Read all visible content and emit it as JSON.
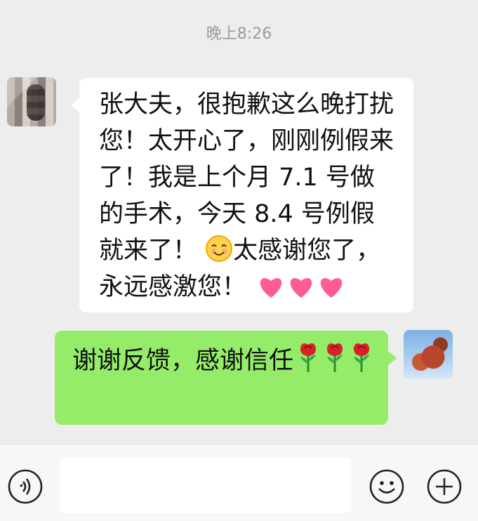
{
  "chat": {
    "timestamp": "晚上8:26",
    "messages": [
      {
        "direction": "incoming",
        "text_before_emoji": "张大夫，很抱歉这么晚打扰您！太开心了，刚刚例假来了！我是上个月 7.1 号做的手术，今天 8.4 号例假就来了！",
        "emoji_1": "smiling-face",
        "text_after_emoji": "太感谢您了，永远感激您！",
        "emoji_2": "three-hearts"
      },
      {
        "direction": "outgoing",
        "text": "谢谢反馈，感谢信任",
        "emoji": "three-roses"
      }
    ]
  },
  "toolbar": {
    "voice_icon": "voice-icon",
    "emoji_icon": "emoji-icon",
    "add_icon": "add-icon"
  },
  "colors": {
    "background": "#ededed",
    "incoming_bubble": "#ffffff",
    "outgoing_bubble": "#95ec69",
    "timestamp": "#9a9a9a",
    "heart": "#ff4f86"
  }
}
